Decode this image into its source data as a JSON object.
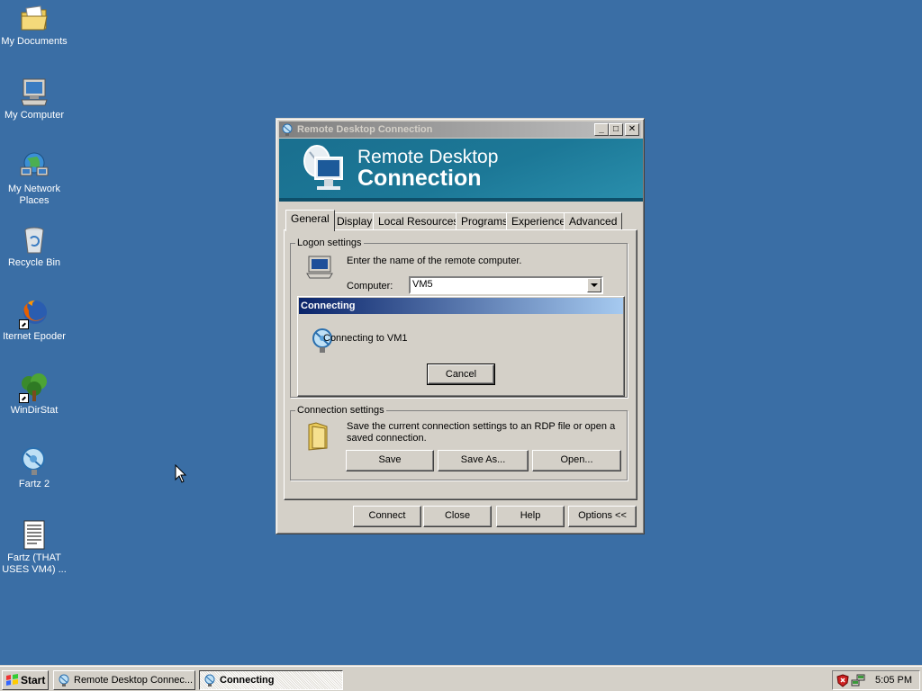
{
  "desktop": {
    "icons": [
      {
        "label": "My Documents"
      },
      {
        "label": "My Computer"
      },
      {
        "label": "My Network\nPlaces"
      },
      {
        "label": "Recycle Bin"
      },
      {
        "label": "Iternet Epoder"
      },
      {
        "label": "WinDirStat"
      },
      {
        "label": "Fartz 2"
      },
      {
        "label": "Fartz (THAT\nUSES VM4) ..."
      }
    ]
  },
  "window": {
    "title": "Remote Desktop Connection",
    "controls": {
      "minimize": "_",
      "maximize": "□",
      "close": "✕"
    },
    "banner": {
      "line1": "Remote Desktop",
      "line2": "Connection"
    },
    "tabs": [
      "General",
      "Display",
      "Local Resources",
      "Programs",
      "Experience",
      "Advanced"
    ],
    "active_tab": "General",
    "logon": {
      "legend": "Logon settings",
      "instruction": "Enter the name of the remote computer.",
      "computer_label": "Computer:",
      "computer_value": "VM5"
    },
    "connection_settings": {
      "legend": "Connection settings",
      "description_line1": "Save the current connection settings to an RDP file or open a",
      "description_line2": "saved connection.",
      "save": "Save",
      "save_as": "Save As...",
      "open": "Open..."
    },
    "buttons": {
      "connect": "Connect",
      "close": "Close",
      "help": "Help",
      "options": "Options <<"
    }
  },
  "connecting_dialog": {
    "title": "Connecting",
    "message": "Connecting to VM1",
    "cancel": "Cancel"
  },
  "taskbar": {
    "start": "Start",
    "tasks": [
      {
        "label": "Remote Desktop Connec...",
        "active": false
      },
      {
        "label": "Connecting",
        "active": true
      }
    ],
    "clock": "5:05 PM"
  }
}
